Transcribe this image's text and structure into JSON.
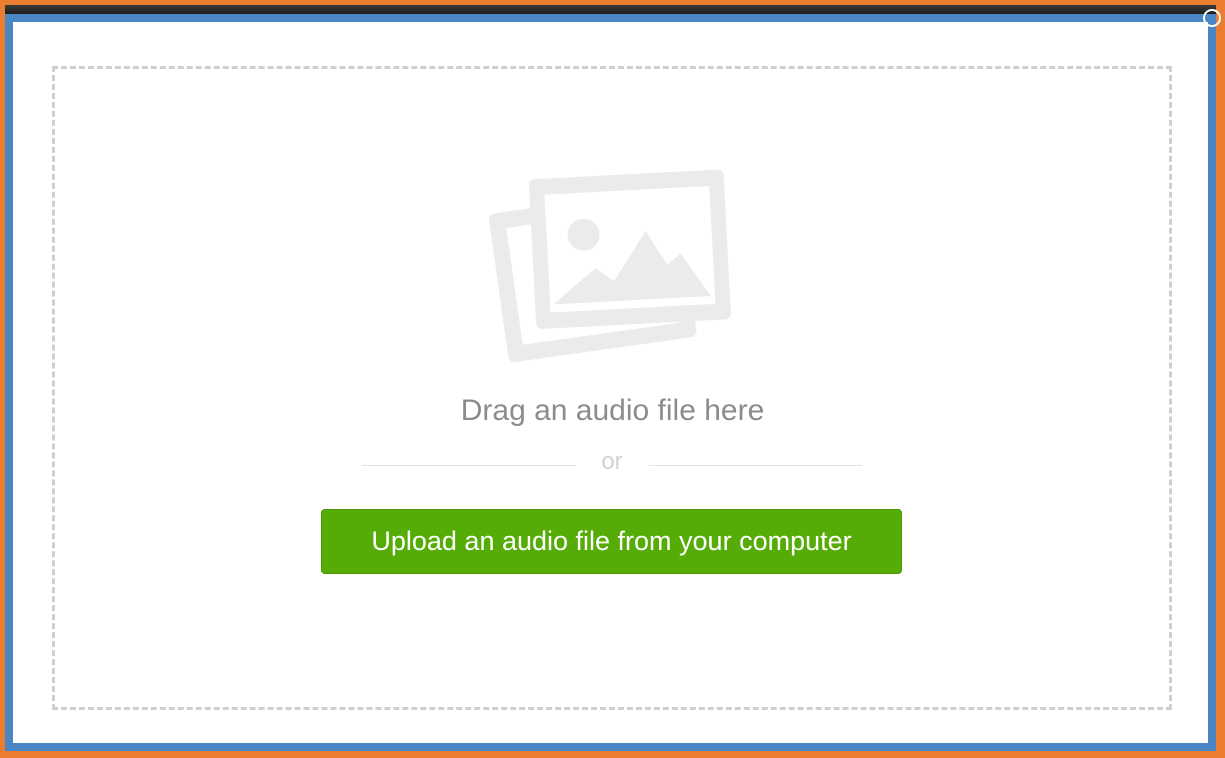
{
  "dropzone": {
    "icon": "picture-icon",
    "drag_text": "Drag an audio file here",
    "separator_text": "or",
    "upload_button_label": "Upload an audio file from your computer"
  },
  "window": {
    "close_icon": "close-icon"
  },
  "colors": {
    "accent_button": "#55ac06",
    "frame_outer": "#ea7d2f",
    "frame_inner": "#4a86c5",
    "dropzone_border": "#cfcfcf",
    "icon_color": "#ebebeb",
    "muted_text": "#8c8c8c"
  }
}
